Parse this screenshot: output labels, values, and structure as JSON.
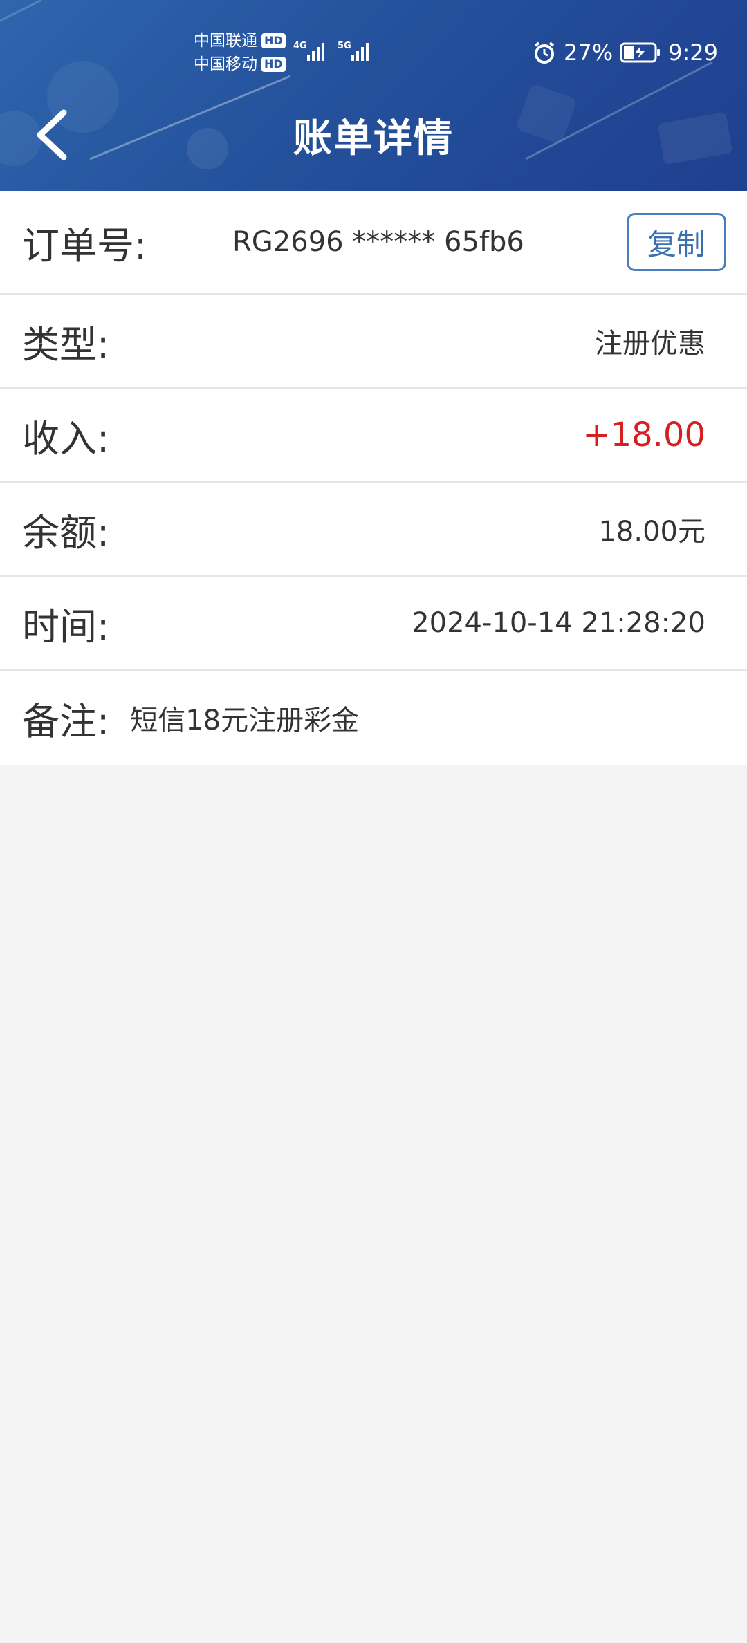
{
  "status_bar": {
    "carrier1": "中国联通",
    "carrier2": "中国移动",
    "hd": "HD",
    "net1": "4G",
    "net2": "5G",
    "battery": "27%",
    "time": "9:29"
  },
  "nav": {
    "title": "账单详情",
    "back_icon": "chevron-left-icon"
  },
  "details": {
    "order_label": "订单号:",
    "order_value": "RG2696 ****** 65fb6",
    "copy_label": "复制",
    "type_label": "类型:",
    "type_value": "注册优惠",
    "income_label": "收入:",
    "income_value": "+18.00",
    "balance_label": "余额:",
    "balance_value": "18.00元",
    "time_label": "时间:",
    "time_value": "2024-10-14 21:28:20",
    "remark_label": "备注:",
    "remark_value": "短信18元注册彩金"
  },
  "colors": {
    "header": "#24519b",
    "income": "#d61f1f",
    "copy_border": "#4a7fbf"
  }
}
